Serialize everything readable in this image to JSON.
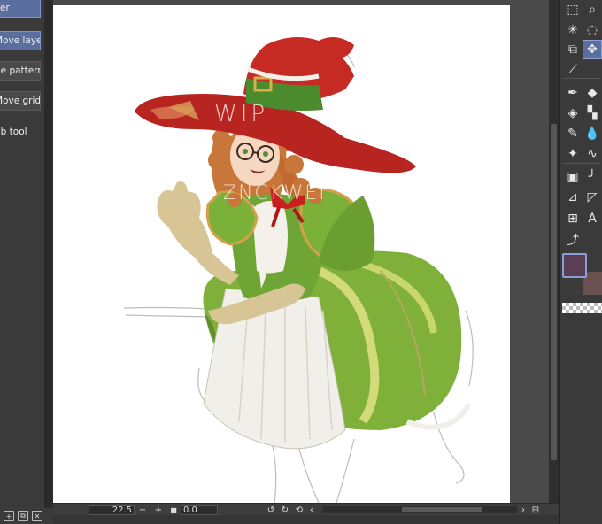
{
  "sub_tools": [
    {
      "label": "er",
      "active": true
    },
    {
      "label": "Move layer",
      "active": true
    },
    {
      "label": "ne pattern",
      "active": false
    },
    {
      "label": "Move grid",
      "active": false
    },
    {
      "label": "ub tool",
      "active": false
    }
  ],
  "canvas": {
    "watermark_top": "WIP",
    "watermark_bottom": "ZNCKWEI"
  },
  "status_bar": {
    "zoom_value": "22.5",
    "zoom_out": "−",
    "zoom_in": "+",
    "stop": "■",
    "angle_value": "0.0",
    "rotate_left": "↺",
    "rotate_right": "↻",
    "reset": "⟲",
    "scroll_left": "‹",
    "scroll_right": "›",
    "fit": "⊟"
  },
  "colors": {
    "main": "#5a3e55",
    "sub": "#6b5050",
    "accent": "#5b6f9e"
  },
  "tools": [
    {
      "name": "selection-icon",
      "glyph": "⬚"
    },
    {
      "name": "magnifier-icon",
      "glyph": "⌕"
    },
    {
      "name": "magic-wand-icon",
      "glyph": "✳"
    },
    {
      "name": "lasso-icon",
      "glyph": "◌"
    },
    {
      "name": "layer-move-icon",
      "glyph": "⧉"
    },
    {
      "name": "move-icon",
      "glyph": "✥"
    },
    {
      "name": "eyedropper-icon",
      "glyph": "⟋"
    },
    {
      "name": "pen-icon",
      "glyph": "✒"
    },
    {
      "name": "eraser-icon",
      "glyph": "◆"
    },
    {
      "name": "fill-icon",
      "glyph": "◈"
    },
    {
      "name": "decoration-icon",
      "glyph": "▚"
    },
    {
      "name": "brush-icon",
      "glyph": "✎"
    },
    {
      "name": "blend-icon",
      "glyph": "💧"
    },
    {
      "name": "sparkle-icon",
      "glyph": "✦"
    },
    {
      "name": "vector-icon",
      "glyph": "∿"
    },
    {
      "name": "gradient-icon",
      "glyph": "▣"
    },
    {
      "name": "curve-icon",
      "glyph": "╯"
    },
    {
      "name": "ruler-icon",
      "glyph": "⊿"
    },
    {
      "name": "frame-icon",
      "glyph": "◸"
    },
    {
      "name": "panel-icon",
      "glyph": "⊞"
    },
    {
      "name": "text-icon",
      "glyph": "A"
    },
    {
      "name": "correct-line-icon",
      "glyph": "⤴"
    }
  ],
  "bottom_icons": [
    "new-layer-icon",
    "copy-icon",
    "trash-icon"
  ]
}
